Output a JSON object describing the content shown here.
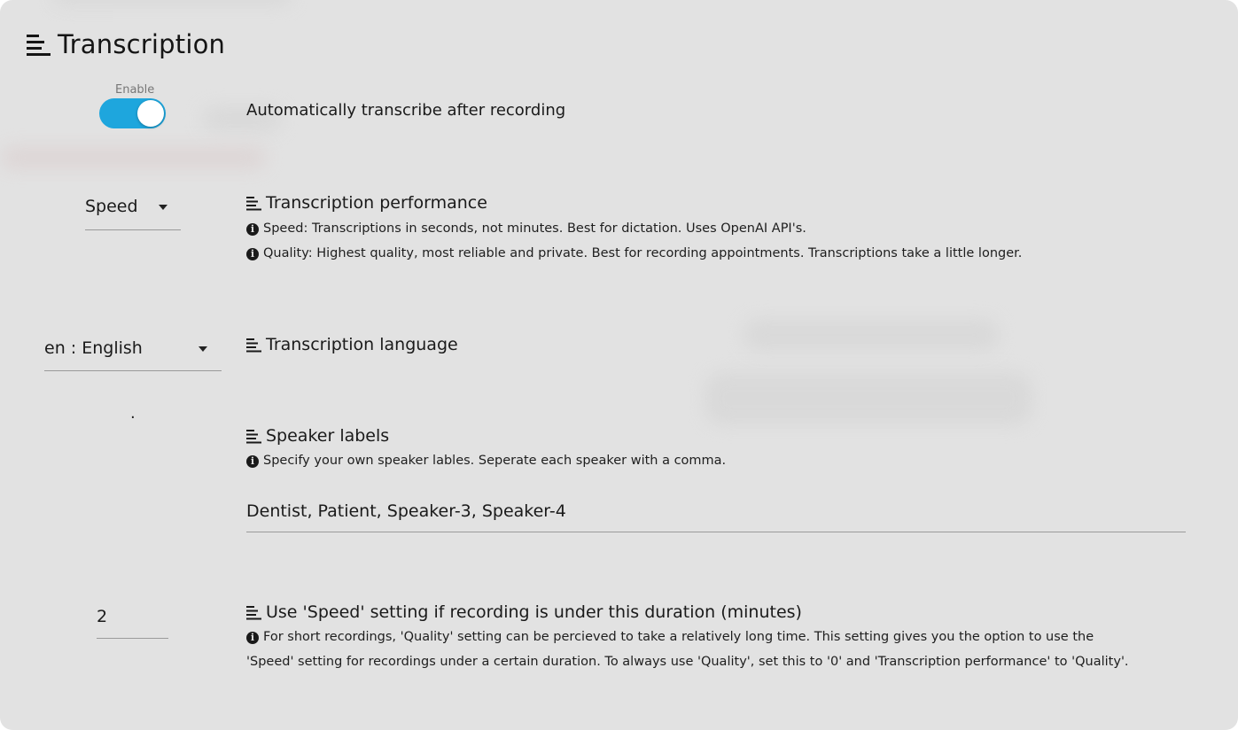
{
  "page": {
    "title": "Transcription"
  },
  "auto_transcribe": {
    "toggle_label": "Enable",
    "enabled": true,
    "description": "Automatically transcribe after recording"
  },
  "performance": {
    "selected": "Speed",
    "heading": "Transcription performance",
    "info": [
      "Speed: Transcriptions in seconds, not minutes. Best for dictation. Uses OpenAI API's.",
      "Quality: Highest quality, most reliable and private. Best for recording appointments. Transcriptions take a little longer."
    ]
  },
  "language": {
    "selected": "en : English",
    "heading": "Transcription language"
  },
  "speakers": {
    "marker": ".",
    "heading": "Speaker labels",
    "info": "Specify your own speaker lables. Seperate each speaker with a comma.",
    "value": "Dentist, Patient, Speaker-3, Speaker-4"
  },
  "duration": {
    "value": "2",
    "heading": "Use 'Speed' setting if recording is under this duration (minutes)",
    "info_line1": "For short recordings, 'Quality' setting can be percieved to take a relatively long time. This setting gives you the option to use the",
    "info_line2": "'Speed' setting for recordings under a certain duration. To always use 'Quality', set this to '0' and 'Transcription performance' to 'Quality'."
  },
  "colors": {
    "accent": "#1ea6dd",
    "panel_bg": "#e2e2e2",
    "text": "#1a1a1a"
  },
  "icons": {
    "section": "lines-icon",
    "info": "info-circle-icon"
  }
}
